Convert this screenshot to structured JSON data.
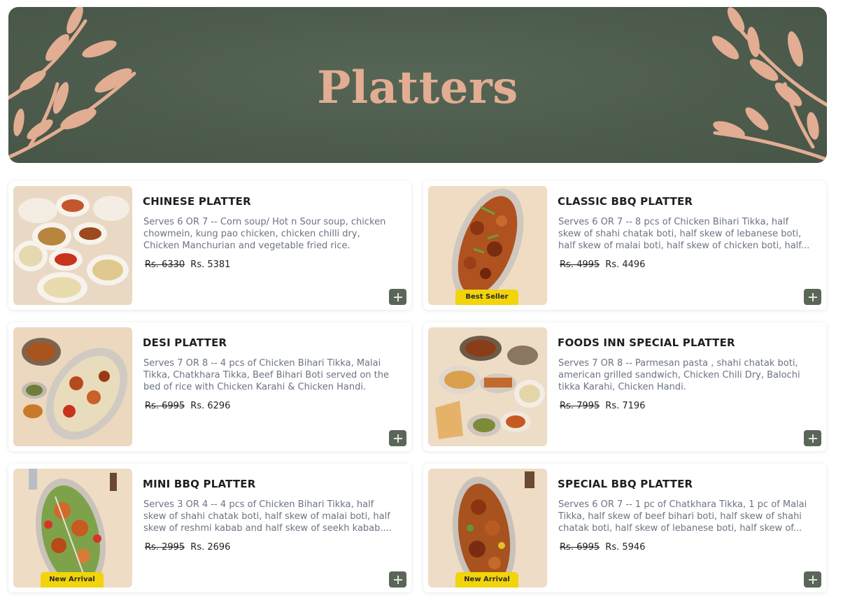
{
  "banner": {
    "title": "Platters"
  },
  "colors": {
    "banner_bg": "#4d5c4d",
    "leaf": "#e2ad92",
    "badge": "#f2d40b",
    "add_button": "#5a6657"
  },
  "products": [
    {
      "title": "CHINESE PLATTER",
      "description": "Serves 6 OR 7 -- Corn soup/ Hot n Sour soup, chicken chowmein, kung pao chicken, chicken chilli dry, Chicken Manchurian and vegetable fried rice.",
      "old_price": "Rs. 6330",
      "price": "Rs. 5381",
      "badge": ""
    },
    {
      "title": "CLASSIC BBQ PLATTER",
      "description": "Serves 6 OR 7 -- 8 pcs of Chicken Bihari Tikka, half skew of shahi chatak boti, half skew of lebanese boti, half skew of malai boti, half skew of chicken boti, half...",
      "old_price": "Rs. 4995",
      "price": "Rs. 4496",
      "badge": "Best Seller"
    },
    {
      "title": "DESI PLATTER",
      "description": "Serves 7 OR 8 -- 4 pcs of Chicken Bihari Tikka, Malai Tikka, Chatkhara Tikka, Beef Bihari Boti served on the bed of rice with Chicken Karahi & Chicken Handi.",
      "old_price": "Rs. 6995",
      "price": "Rs. 6296",
      "badge": ""
    },
    {
      "title": "FOODS INN SPECIAL PLATTER",
      "description": "Serves 7 OR 8 -- Parmesan pasta , shahi chatak boti, american grilled sandwich, Chicken Chili Dry, Balochi tikka Karahi, Chicken Handi.",
      "old_price": "Rs. 7995",
      "price": "Rs. 7196",
      "badge": ""
    },
    {
      "title": "MINI BBQ PLATTER",
      "description": "Serves 3 OR 4 -- 4 pcs of Chicken Bihari Tikka, half skew of shahi chatak boti, half skew of malai boti, half skew of reshmi kabab and half skew of seekh kabab....",
      "old_price": "Rs. 2995",
      "price": "Rs. 2696",
      "badge": "New Arrival"
    },
    {
      "title": "SPECIAL BBQ PLATTER",
      "description": "Serves 6 OR 7 -- 1 pc of Chatkhara Tikka, 1 pc of Malai Tikka, half skew of beef bihari boti, half skew of shahi chatak boti, half skew of lebanese boti, half skew of...",
      "old_price": "Rs. 6995",
      "price": "Rs. 5946",
      "badge": "New Arrival"
    }
  ]
}
